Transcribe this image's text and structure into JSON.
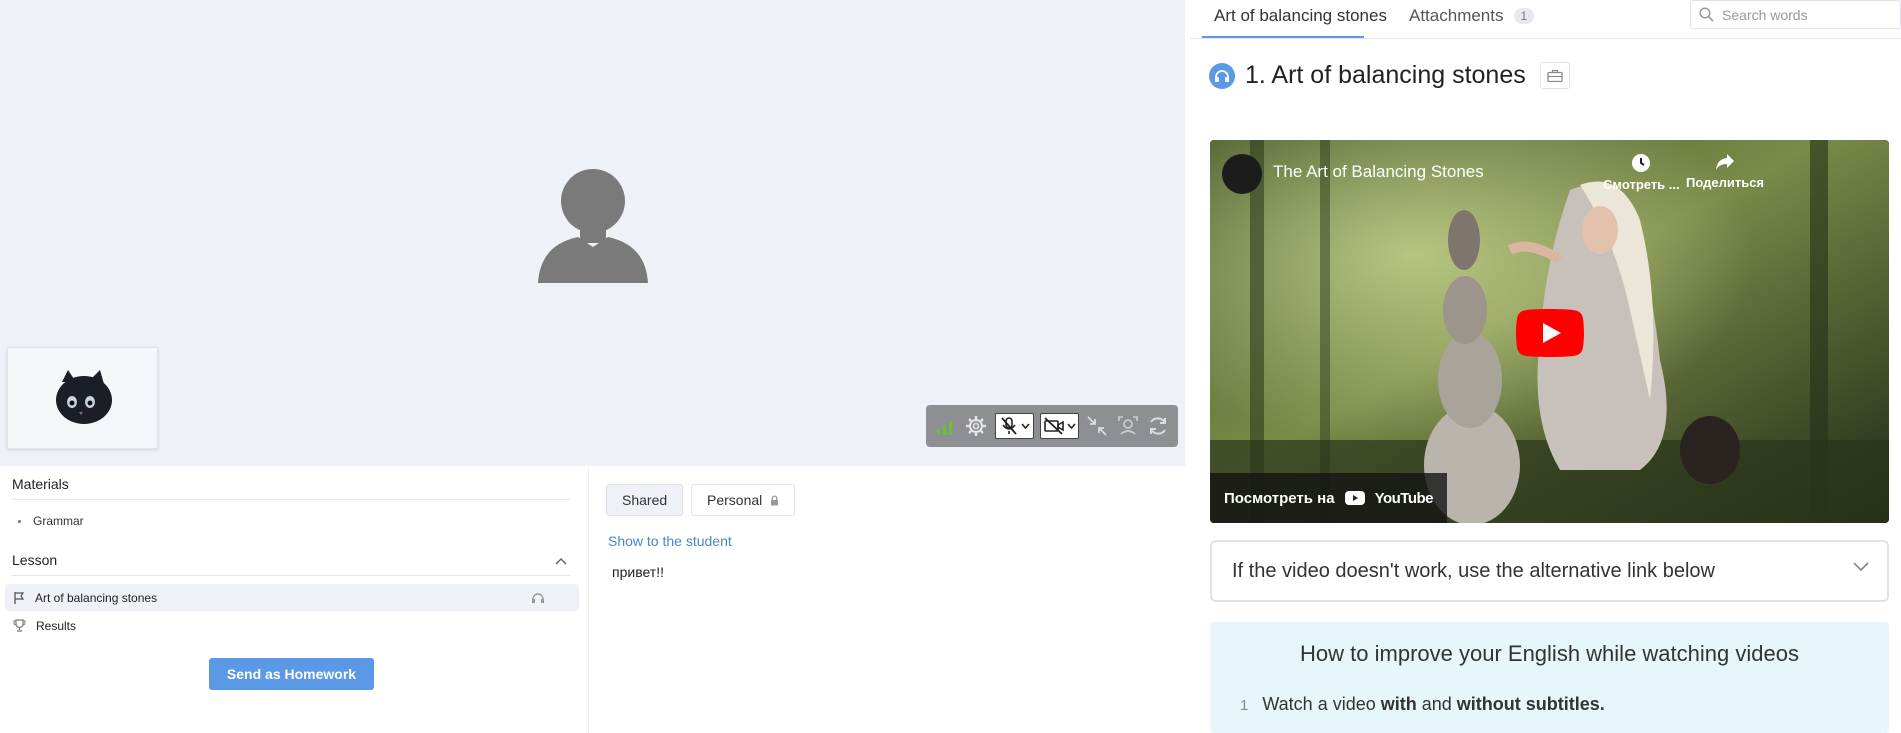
{
  "materials": {
    "title": "Materials",
    "items": [
      "Grammar"
    ]
  },
  "lesson": {
    "title": "Lesson",
    "items": [
      {
        "label": "Art of balancing stones",
        "icon": "flag-icon",
        "active": true
      },
      {
        "label": "Results",
        "icon": "trophy-icon",
        "active": false
      }
    ],
    "send_button": "Send as Homework"
  },
  "notes": {
    "tabs": [
      {
        "label": "Shared",
        "active": true
      },
      {
        "label": "Personal",
        "locked": true
      }
    ],
    "show_link": "Show to the student",
    "text": "привет!!"
  },
  "right_panel": {
    "tabs": [
      {
        "label": "Art of balancing stones",
        "active": true
      },
      {
        "label": "Attachments",
        "badge": "1"
      }
    ],
    "search_placeholder": "Search words",
    "exercise_title": "1. Art of balancing stones",
    "video": {
      "title": "The Art of Balancing Stones",
      "watch_later": "Смотреть ...",
      "share": "Поделиться",
      "watch_on": "Посмотреть на",
      "brand": "YouTube"
    },
    "accordion_text": "If the video doesn't work, use the alternative link below",
    "tips": {
      "title": "How to improve your English while watching videos",
      "items": [
        {
          "num": "1",
          "parts": [
            "Watch a video ",
            "with",
            " and ",
            "without subtitles."
          ]
        }
      ]
    }
  },
  "colors": {
    "accent": "#5b98e6",
    "stage_bg": "#eef1f7",
    "tips_bg": "#e6f6fb",
    "youtube_red": "#ff0000"
  }
}
